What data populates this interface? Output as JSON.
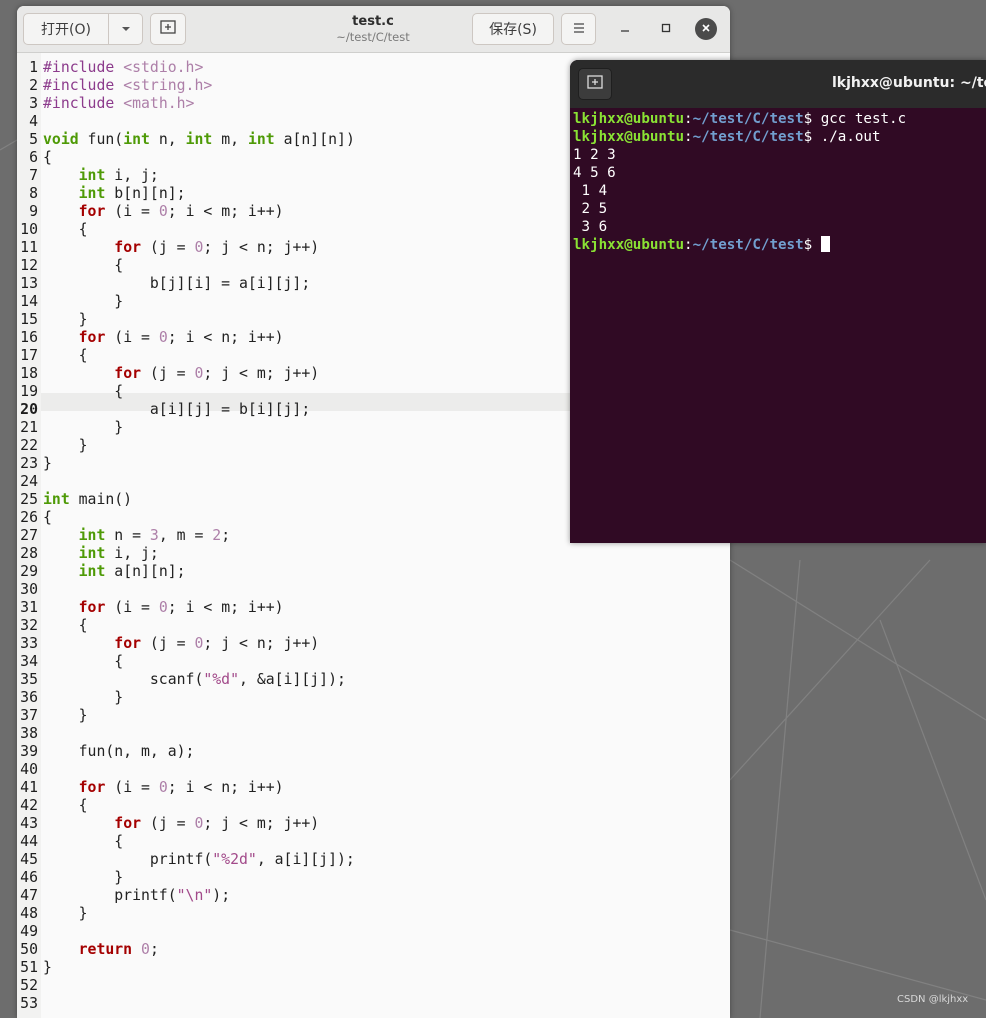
{
  "editor_window": {
    "title": "test.c",
    "subtitle": "~/test/C/test",
    "open_label": "打开(O)",
    "open_dropdown_icon": "chevron-down-icon",
    "new_tab_icon": "new-tab-icon",
    "save_label": "保存(S)",
    "menu_icon": "hamburger-menu-icon",
    "minimize_icon": "minimize-icon",
    "maximize_icon": "maximize-icon",
    "close_icon": "close-icon",
    "current_line": 20,
    "lines": [
      {
        "n": "1",
        "parts": [
          {
            "t": "pp",
            "v": "#include "
          },
          {
            "t": "inc",
            "v": "<stdio.h>"
          }
        ]
      },
      {
        "n": "2",
        "parts": [
          {
            "t": "pp",
            "v": "#include "
          },
          {
            "t": "inc",
            "v": "<string.h>"
          }
        ]
      },
      {
        "n": "3",
        "parts": [
          {
            "t": "pp",
            "v": "#include "
          },
          {
            "t": "inc",
            "v": "<math.h>"
          }
        ]
      },
      {
        "n": "4",
        "parts": []
      },
      {
        "n": "5",
        "parts": [
          {
            "t": "kw",
            "v": "void"
          },
          {
            "t": "txt",
            "v": " fun("
          },
          {
            "t": "kw",
            "v": "int"
          },
          {
            "t": "txt",
            "v": " n, "
          },
          {
            "t": "kw",
            "v": "int"
          },
          {
            "t": "txt",
            "v": " m, "
          },
          {
            "t": "kw",
            "v": "int"
          },
          {
            "t": "txt",
            "v": " a[n][n])"
          }
        ]
      },
      {
        "n": "6",
        "parts": [
          {
            "t": "txt",
            "v": "{"
          }
        ]
      },
      {
        "n": "7",
        "parts": [
          {
            "t": "txt",
            "v": "    "
          },
          {
            "t": "kw",
            "v": "int"
          },
          {
            "t": "txt",
            "v": " i, j;"
          }
        ]
      },
      {
        "n": "8",
        "parts": [
          {
            "t": "txt",
            "v": "    "
          },
          {
            "t": "kw",
            "v": "int"
          },
          {
            "t": "txt",
            "v": " b[n][n];"
          }
        ]
      },
      {
        "n": "9",
        "parts": [
          {
            "t": "txt",
            "v": "    "
          },
          {
            "t": "ctrl",
            "v": "for"
          },
          {
            "t": "txt",
            "v": " (i = "
          },
          {
            "t": "num",
            "v": "0"
          },
          {
            "t": "txt",
            "v": "; i < m; i++)"
          }
        ]
      },
      {
        "n": "10",
        "parts": [
          {
            "t": "txt",
            "v": "    {"
          }
        ]
      },
      {
        "n": "11",
        "parts": [
          {
            "t": "txt",
            "v": "        "
          },
          {
            "t": "ctrl",
            "v": "for"
          },
          {
            "t": "txt",
            "v": " (j = "
          },
          {
            "t": "num",
            "v": "0"
          },
          {
            "t": "txt",
            "v": "; j < n; j++)"
          }
        ]
      },
      {
        "n": "12",
        "parts": [
          {
            "t": "txt",
            "v": "        {"
          }
        ]
      },
      {
        "n": "13",
        "parts": [
          {
            "t": "txt",
            "v": "            b[j][i] = a[i][j];"
          }
        ]
      },
      {
        "n": "14",
        "parts": [
          {
            "t": "txt",
            "v": "        }"
          }
        ]
      },
      {
        "n": "15",
        "parts": [
          {
            "t": "txt",
            "v": "    }"
          }
        ]
      },
      {
        "n": "16",
        "parts": [
          {
            "t": "txt",
            "v": "    "
          },
          {
            "t": "ctrl",
            "v": "for"
          },
          {
            "t": "txt",
            "v": " (i = "
          },
          {
            "t": "num",
            "v": "0"
          },
          {
            "t": "txt",
            "v": "; i < n; i++)"
          }
        ]
      },
      {
        "n": "17",
        "parts": [
          {
            "t": "txt",
            "v": "    {"
          }
        ]
      },
      {
        "n": "18",
        "parts": [
          {
            "t": "txt",
            "v": "        "
          },
          {
            "t": "ctrl",
            "v": "for"
          },
          {
            "t": "txt",
            "v": " (j = "
          },
          {
            "t": "num",
            "v": "0"
          },
          {
            "t": "txt",
            "v": "; j < m; j++)"
          }
        ]
      },
      {
        "n": "19",
        "parts": [
          {
            "t": "txt",
            "v": "        {"
          }
        ]
      },
      {
        "n": "20",
        "parts": [
          {
            "t": "txt",
            "v": "            a[i][j] = b[i][j];"
          }
        ]
      },
      {
        "n": "21",
        "parts": [
          {
            "t": "txt",
            "v": "        }"
          }
        ]
      },
      {
        "n": "22",
        "parts": [
          {
            "t": "txt",
            "v": "    }"
          }
        ]
      },
      {
        "n": "23",
        "parts": [
          {
            "t": "txt",
            "v": "}"
          }
        ]
      },
      {
        "n": "24",
        "parts": []
      },
      {
        "n": "25",
        "parts": [
          {
            "t": "kw",
            "v": "int"
          },
          {
            "t": "txt",
            "v": " main()"
          }
        ]
      },
      {
        "n": "26",
        "parts": [
          {
            "t": "txt",
            "v": "{"
          }
        ]
      },
      {
        "n": "27",
        "parts": [
          {
            "t": "txt",
            "v": "    "
          },
          {
            "t": "kw",
            "v": "int"
          },
          {
            "t": "txt",
            "v": " n = "
          },
          {
            "t": "num",
            "v": "3"
          },
          {
            "t": "txt",
            "v": ", m = "
          },
          {
            "t": "num",
            "v": "2"
          },
          {
            "t": "txt",
            "v": ";"
          }
        ]
      },
      {
        "n": "28",
        "parts": [
          {
            "t": "txt",
            "v": "    "
          },
          {
            "t": "kw",
            "v": "int"
          },
          {
            "t": "txt",
            "v": " i, j;"
          }
        ]
      },
      {
        "n": "29",
        "parts": [
          {
            "t": "txt",
            "v": "    "
          },
          {
            "t": "kw",
            "v": "int"
          },
          {
            "t": "txt",
            "v": " a[n][n];"
          }
        ]
      },
      {
        "n": "30",
        "parts": []
      },
      {
        "n": "31",
        "parts": [
          {
            "t": "txt",
            "v": "    "
          },
          {
            "t": "ctrl",
            "v": "for"
          },
          {
            "t": "txt",
            "v": " (i = "
          },
          {
            "t": "num",
            "v": "0"
          },
          {
            "t": "txt",
            "v": "; i < m; i++)"
          }
        ]
      },
      {
        "n": "32",
        "parts": [
          {
            "t": "txt",
            "v": "    {"
          }
        ]
      },
      {
        "n": "33",
        "parts": [
          {
            "t": "txt",
            "v": "        "
          },
          {
            "t": "ctrl",
            "v": "for"
          },
          {
            "t": "txt",
            "v": " (j = "
          },
          {
            "t": "num",
            "v": "0"
          },
          {
            "t": "txt",
            "v": "; j < n; j++)"
          }
        ]
      },
      {
        "n": "34",
        "parts": [
          {
            "t": "txt",
            "v": "        {"
          }
        ]
      },
      {
        "n": "35",
        "parts": [
          {
            "t": "txt",
            "v": "            scanf("
          },
          {
            "t": "str",
            "v": "\"%d\""
          },
          {
            "t": "txt",
            "v": ", &a[i][j]);"
          }
        ]
      },
      {
        "n": "36",
        "parts": [
          {
            "t": "txt",
            "v": "        }"
          }
        ]
      },
      {
        "n": "37",
        "parts": [
          {
            "t": "txt",
            "v": "    }"
          }
        ]
      },
      {
        "n": "38",
        "parts": []
      },
      {
        "n": "39",
        "parts": [
          {
            "t": "txt",
            "v": "    fun(n, m, a);"
          }
        ]
      },
      {
        "n": "40",
        "parts": []
      },
      {
        "n": "41",
        "parts": [
          {
            "t": "txt",
            "v": "    "
          },
          {
            "t": "ctrl",
            "v": "for"
          },
          {
            "t": "txt",
            "v": " (i = "
          },
          {
            "t": "num",
            "v": "0"
          },
          {
            "t": "txt",
            "v": "; i < n; i++)"
          }
        ]
      },
      {
        "n": "42",
        "parts": [
          {
            "t": "txt",
            "v": "    {"
          }
        ]
      },
      {
        "n": "43",
        "parts": [
          {
            "t": "txt",
            "v": "        "
          },
          {
            "t": "ctrl",
            "v": "for"
          },
          {
            "t": "txt",
            "v": " (j = "
          },
          {
            "t": "num",
            "v": "0"
          },
          {
            "t": "txt",
            "v": "; j < m; j++)"
          }
        ]
      },
      {
        "n": "44",
        "parts": [
          {
            "t": "txt",
            "v": "        {"
          }
        ]
      },
      {
        "n": "45",
        "parts": [
          {
            "t": "txt",
            "v": "            printf("
          },
          {
            "t": "str",
            "v": "\"%2d\""
          },
          {
            "t": "txt",
            "v": ", a[i][j]);"
          }
        ]
      },
      {
        "n": "46",
        "parts": [
          {
            "t": "txt",
            "v": "        }"
          }
        ]
      },
      {
        "n": "47",
        "parts": [
          {
            "t": "txt",
            "v": "        printf("
          },
          {
            "t": "str",
            "v": "\"\\n\""
          },
          {
            "t": "txt",
            "v": ");"
          }
        ]
      },
      {
        "n": "48",
        "parts": [
          {
            "t": "txt",
            "v": "    }"
          }
        ]
      },
      {
        "n": "49",
        "parts": []
      },
      {
        "n": "50",
        "parts": [
          {
            "t": "txt",
            "v": "    "
          },
          {
            "t": "ctrl",
            "v": "return"
          },
          {
            "t": "txt",
            "v": " "
          },
          {
            "t": "num",
            "v": "0"
          },
          {
            "t": "txt",
            "v": ";"
          }
        ]
      },
      {
        "n": "51",
        "parts": [
          {
            "t": "txt",
            "v": "}"
          }
        ]
      },
      {
        "n": "52",
        "parts": []
      },
      {
        "n": "53",
        "parts": []
      }
    ]
  },
  "terminal_window": {
    "title": "lkjhxx@ubuntu: ~/tes",
    "new_tab_icon": "new-tab-icon",
    "lines": [
      {
        "user": "lkjhxx@ubuntu",
        "sep": ":",
        "path": "~/test/C/test",
        "cmd": "$ gcc test.c"
      },
      {
        "user": "lkjhxx@ubuntu",
        "sep": ":",
        "path": "~/test/C/test",
        "cmd": "$ ./a.out"
      },
      {
        "out": "1 2 3"
      },
      {
        "out": "4 5 6"
      },
      {
        "out": " 1 4"
      },
      {
        "out": " 2 5"
      },
      {
        "out": " 3 6"
      },
      {
        "user": "lkjhxx@ubuntu",
        "sep": ":",
        "path": "~/test/C/test",
        "cmd": "$ ",
        "cursor": true
      }
    ]
  },
  "watermark": "CSDN @lkjhxx",
  "colors": {
    "keyword": "#4e9a06",
    "control": "#a40000",
    "number": "#ad7fa8",
    "terminal_bg": "#300a24",
    "prompt_user": "#8ae234",
    "prompt_path": "#729fcf"
  }
}
